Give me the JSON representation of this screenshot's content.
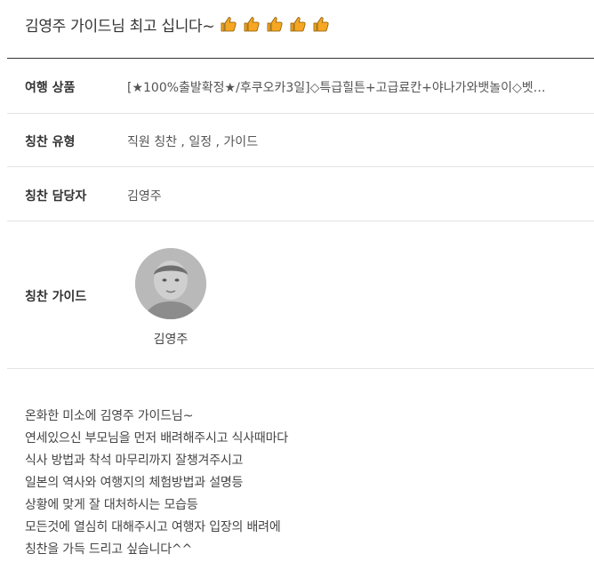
{
  "review": {
    "title": "김영주 가이드님 최고 십니다~",
    "thumbs": [
      "thumbs-up-icon",
      "thumbs-up-icon",
      "thumbs-up-icon",
      "thumbs-up-icon",
      "thumbs-up-icon"
    ],
    "accent_color": "#f5a623"
  },
  "details": {
    "product_label": "여행 상품",
    "product_value": "[★100%출발확정★/후쿠오카3일]◇특급힐튼+고급료칸+야나가와뱃놀이◇벳…",
    "type_label": "칭찬 유형",
    "type_value": "직원 칭찬 , 일정 , 가이드",
    "manager_label": "칭찬 담당자",
    "manager_value": "김영주",
    "guide_label": "칭찬 가이드",
    "guide_name": "김영주"
  },
  "content": {
    "lines": [
      "온화한 미소에 김영주 가이드님~",
      "연세있으신 부모님을 먼저 배려해주시고 식사때마다",
      "식사 방법과 착석 마무리까지 잘챙겨주시고",
      "일본의 역사와 여행지의 체험방법과 설명등",
      "상황에 맞게 잘 대처하시는 모습등",
      "모든것에 열심히 대해주시고 여행자 입장의 배려에",
      "칭찬을 가득 드리고 싶습니다^^"
    ]
  }
}
